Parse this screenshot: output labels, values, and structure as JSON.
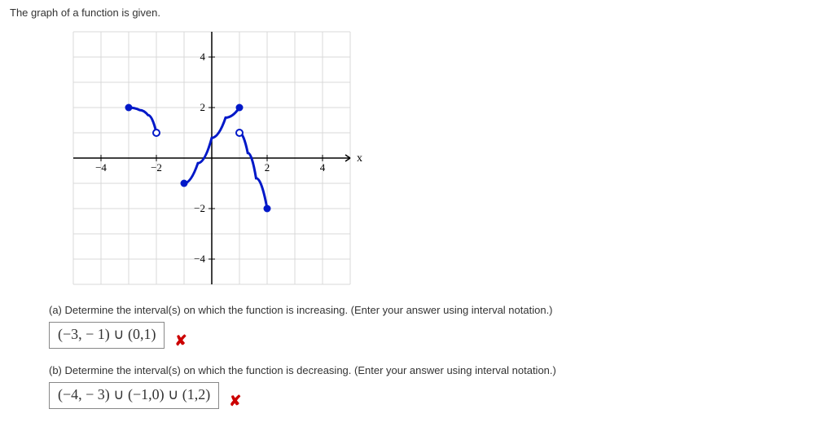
{
  "intro": "The graph of a function is given.",
  "chart_data": {
    "type": "line",
    "xlabel": "x",
    "ylabel": "",
    "xlim": [
      -5,
      5
    ],
    "ylim": [
      -5,
      5
    ],
    "x_ticks": [
      -4,
      -2,
      2,
      4
    ],
    "y_ticks": [
      -4,
      -2,
      2,
      4
    ],
    "series": [
      {
        "name": "segment1",
        "points": [
          [
            -3,
            2
          ],
          [
            -2.6,
            1.9
          ],
          [
            -2.3,
            1.7
          ],
          [
            -2,
            1
          ]
        ],
        "start_style": "closed",
        "end_style": "open"
      },
      {
        "name": "segment2",
        "points": [
          [
            -1,
            -1
          ],
          [
            -0.5,
            -0.2
          ],
          [
            0,
            0.8
          ],
          [
            0.5,
            1.6
          ],
          [
            1,
            2
          ]
        ],
        "start_style": "closed",
        "end_style": "closed"
      },
      {
        "name": "segment3",
        "points": [
          [
            1,
            1
          ],
          [
            1.3,
            0.2
          ],
          [
            1.6,
            -0.8
          ],
          [
            2,
            -2
          ]
        ],
        "start_style": "open",
        "end_style": "closed"
      }
    ]
  },
  "part_a": {
    "prompt": "(a) Determine the interval(s) on which the function is increasing. (Enter your answer using interval notation.)",
    "answer": "(−3, − 1) ∪ (0,1)",
    "mark": "✘"
  },
  "part_b": {
    "prompt": "(b) Determine the interval(s) on which the function is decreasing. (Enter your answer using interval notation.)",
    "answer": "(−4, − 3) ∪ (−1,0) ∪ (1,2)",
    "mark": "✘"
  }
}
